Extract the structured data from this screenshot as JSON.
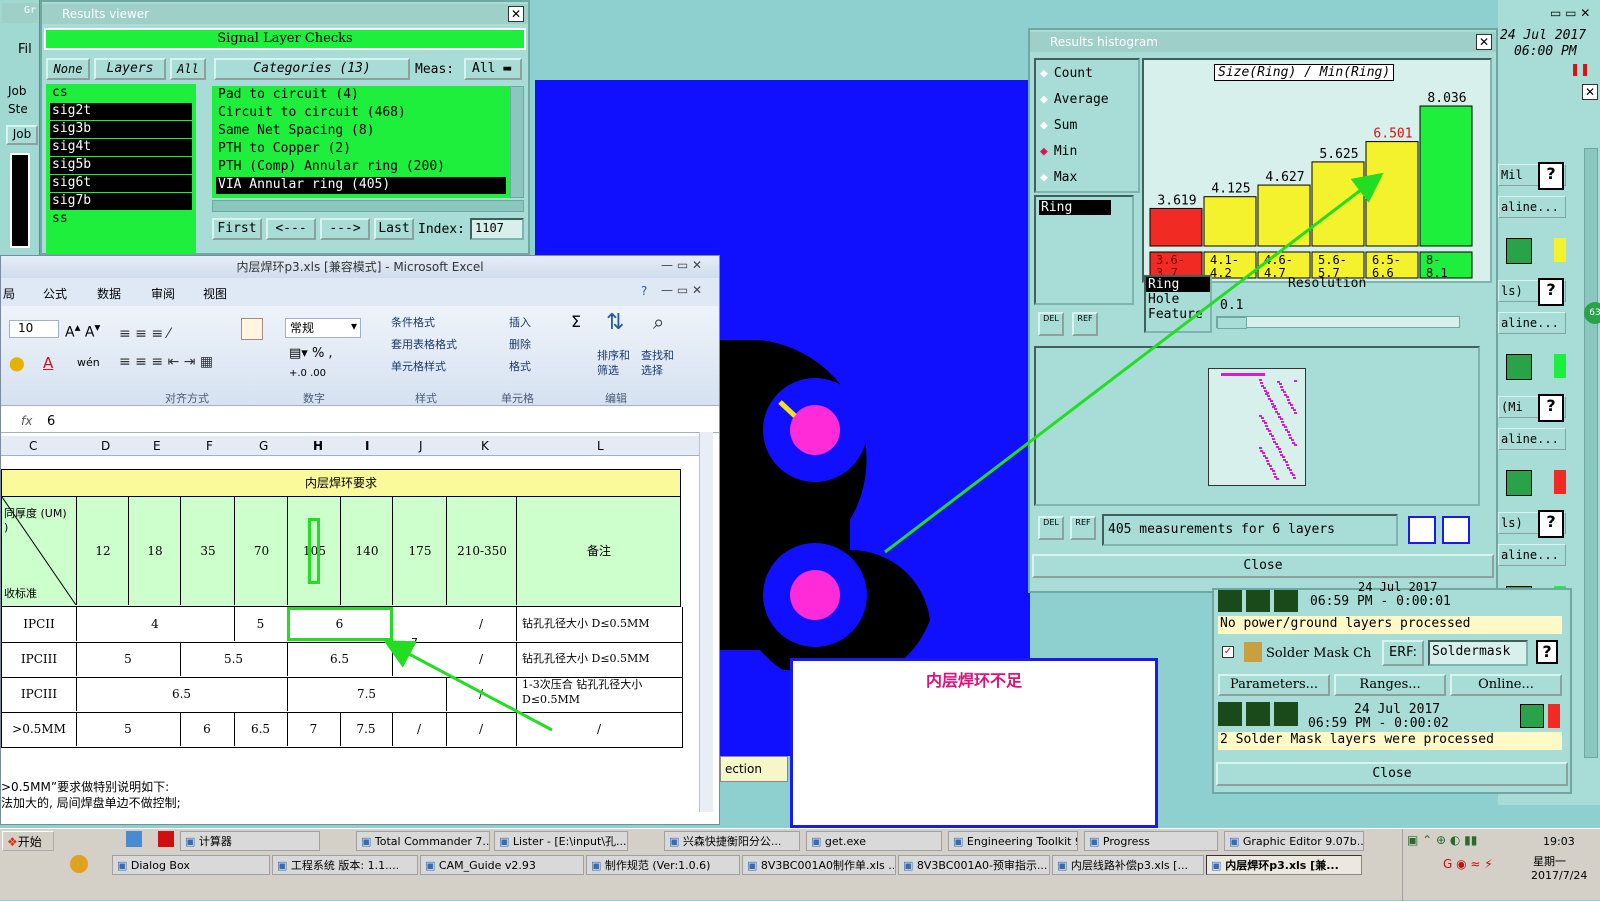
{
  "results_viewer": {
    "title": "Results viewer",
    "header": "Signal Layer Checks",
    "btn_none": "None",
    "btn_layers": "Layers",
    "btn_all": "All",
    "categories_label": "Categories (13)",
    "meas_label": "Meas:",
    "meas_value": "All",
    "layers": [
      "cs",
      "sig2t",
      "sig3b",
      "sig4t",
      "sig5b",
      "sig6t",
      "sig7b",
      "ss"
    ],
    "categories": [
      "Pad to circuit (4)",
      "Circuit to circuit (468)",
      "Same Net Spacing (8)",
      "PTH to Copper (2)",
      "PTH (Comp) Annular ring (200)",
      "VIA Annular ring (405)"
    ],
    "nav_first": "First",
    "nav_prev": "<---",
    "nav_next": "--->",
    "nav_last": "Last",
    "index_label": "Index:",
    "index_value": "1107"
  },
  "left_strip": {
    "items": [
      "Gr",
      "Fil",
      "Job",
      "Ste",
      "Job"
    ]
  },
  "histogram": {
    "title": "Results histogram",
    "modes": [
      "Count",
      "Average",
      "Sum",
      "Min",
      "Max"
    ],
    "selected_mode": "Min",
    "list_item": "Ring",
    "chart_title": "Size(Ring) / Min(Ring)",
    "bar_values": [
      "3.619",
      "4.125",
      "4.627",
      "5.625",
      "6.501",
      "8.036"
    ],
    "bin_labels": [
      "3.6-\n3.7",
      "4.1-\n4.2",
      "4.6-\n4.7",
      "5.6-\n5.7",
      "6.5-\n6.6",
      "8-\n8.1"
    ],
    "feature_list": [
      "Ring",
      "Hole",
      "Feature"
    ],
    "resolution_label": "Resolution",
    "resolution_value": "0.1",
    "del": "DEL",
    "ref": "REF",
    "summary": "405 measurements for 6 layers",
    "close": "Close"
  },
  "right_panel": {
    "date_line1": "24 Jul 2017",
    "date_line2": "06:00 PM",
    "rows": [
      "Mil",
      "aline...",
      "ls)",
      "aline...",
      "(Mi",
      "aline...",
      "ls)",
      "aline..."
    ],
    "status1_date": "24 Jul 2017",
    "status1_time": "06:59 PM - 0:00:01",
    "status1_msg": "No power/ground layers processed",
    "solder_label": "Solder Mask Ch",
    "erf_label": "ERF:",
    "erf_value": "Soldermask",
    "parameters": "Parameters...",
    "ranges": "Ranges...",
    "online": "Online...",
    "status2_date": "24 Jul 2017",
    "status2_time": "06:59 PM - 0:00:02",
    "status2_msg": "2 Solder Mask layers were processed",
    "close": "Close"
  },
  "excel": {
    "title": "内层焊环p3.xls [兼容模式] - Microsoft Excel",
    "menus": [
      "局",
      "公式",
      "数据",
      "审阅",
      "视图"
    ],
    "font_size": "10",
    "number_format": "常规",
    "ribbon": {
      "cond_format": "条件格式",
      "table_format": "套用表格格式",
      "cell_style": "单元格样式",
      "insert": "插入",
      "delete": "删除",
      "format": "格式",
      "sort": "排序和\n筛选",
      "find": "查找和\n选择",
      "group_align": "对齐方式",
      "group_number": "数字",
      "group_style": "样式",
      "group_cells": "单元格",
      "group_edit": "编辑"
    },
    "formula_value": "6",
    "columns": [
      "C",
      "D",
      "E",
      "F",
      "G",
      "H",
      "I",
      "J",
      "K",
      "L"
    ],
    "table_title": "内层焊环要求",
    "header_left_top": "同厚度 (UM)\n)",
    "header_left_bottom": "收标准",
    "thickness": [
      "12",
      "18",
      "35",
      "70",
      "105",
      "140",
      "175",
      "210-350"
    ],
    "remark_header": "备注",
    "rows": [
      {
        "label": "IPCII",
        "vals": [
          "4",
          "5",
          "6",
          "/"
        ],
        "remark": "钻孔孔径大小   D≤0.5MM"
      },
      {
        "label": "IPCIII",
        "vals": [
          "5",
          "5.5",
          "6.5",
          "/"
        ],
        "remark": "钻孔孔径大小   D≤0.5MM"
      },
      {
        "label": "IPCIII",
        "vals": [
          "6.5",
          "7.5",
          "/"
        ],
        "remark": "1-3次压合      钻孔孔径大小   D≤0.5MM"
      },
      {
        "label": ">0.5MM",
        "vals": [
          "5",
          "6",
          "6.5",
          "7",
          "7.5",
          "/",
          "/",
          "/"
        ],
        "remark": ""
      }
    ],
    "note1": ">0.5MM”要求做特别说明如下:",
    "note2": "法加大的, 局间焊盘单边不做控制;",
    "stray_digit": "7"
  },
  "callout_text": "内层焊环不足",
  "section_label": "ection",
  "taskbar": {
    "start": "开始",
    "row1": [
      "计算器",
      "Total Commander 7....",
      "Lister - [E:\\input\\孔...",
      "兴森快捷衡阳分公...",
      "get.exe",
      "Engineering Toolkit 9...",
      "Progress",
      "Graphic Editor 9.07b..."
    ],
    "row2": [
      "Dialog Box",
      "工程系统  版本: 1.1....",
      "CAM_Guide v2.93",
      "制作规范 (Ver:1.0.6)",
      "8V3BC001A0制作单.xls ...",
      "8V3BC001A0-预审指示...",
      "内层线路补偿p3.xls [...",
      "内层焊环p3.xls [兼..."
    ],
    "time": "19:03",
    "weekday": "星期一",
    "date": "2017/7/24"
  },
  "colors": {
    "cam_bg": "#1010ff",
    "pad": "#ff2bd9",
    "arrow": "#22dd22"
  }
}
